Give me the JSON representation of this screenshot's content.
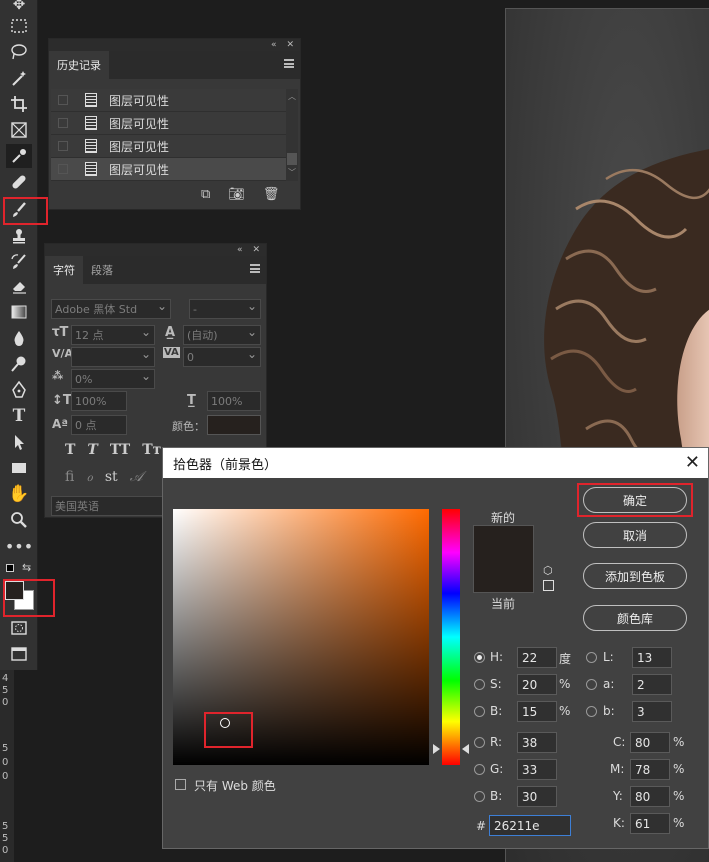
{
  "toolbar": {
    "tools": [
      "move-icon",
      "marquee-icon",
      "lasso-icon",
      "magic-wand-icon",
      "crop-icon",
      "frame-icon",
      "eyedropper-icon",
      "healing-brush-icon",
      "brush-icon",
      "stamp-icon",
      "history-brush-icon",
      "eraser-icon",
      "gradient-icon",
      "blur-icon",
      "dodge-icon",
      "pen-icon",
      "type-icon",
      "path-selection-icon",
      "rectangle-icon",
      "hand-icon",
      "zoom-icon",
      "more-tools-icon"
    ]
  },
  "ruler": {
    "numbers": [
      "4",
      "5",
      "0",
      "5",
      "0",
      "0",
      "5",
      "5",
      "0"
    ]
  },
  "history": {
    "tab": "历史记录",
    "items": [
      "图层可见性",
      "图层可见性",
      "图层可见性",
      "图层可见性"
    ]
  },
  "character": {
    "tabs": [
      "字符",
      "段落"
    ],
    "font_family": "Adobe 黑体 Std",
    "font_style": "-",
    "size": "12 点",
    "leading": "(自动)",
    "kerning": "",
    "tracking": "0",
    "tsume": "0%",
    "vscale": "100%",
    "hscale": "100%",
    "baseline": "0 点",
    "color_label": "颜色：",
    "language": "美国英语",
    "style_row1": [
      "T",
      "T",
      "TT",
      "Tт"
    ],
    "style_row2": [
      "fi",
      "ℴ",
      "st",
      "𝒜"
    ]
  },
  "picker": {
    "title": "拾色器（前景色）",
    "new_label": "新的",
    "current_label": "当前",
    "ok": "确定",
    "cancel": "取消",
    "add_swatch": "添加到色板",
    "color_library": "颜色库",
    "web_only": "只有 Web 颜色",
    "hsb": [
      {
        "label": "H:",
        "value": "22",
        "unit": "度"
      },
      {
        "label": "S:",
        "value": "20",
        "unit": "%"
      },
      {
        "label": "B:",
        "value": "15",
        "unit": "%"
      }
    ],
    "rgb": [
      {
        "label": "R:",
        "value": "38"
      },
      {
        "label": "G:",
        "value": "33"
      },
      {
        "label": "B:",
        "value": "30"
      }
    ],
    "lab": [
      {
        "label": "L:",
        "value": "13"
      },
      {
        "label": "a:",
        "value": "2"
      },
      {
        "label": "b:",
        "value": "3"
      }
    ],
    "cmyk": [
      {
        "label": "C:",
        "value": "80",
        "unit": "%"
      },
      {
        "label": "M:",
        "value": "78",
        "unit": "%"
      },
      {
        "label": "Y:",
        "value": "80",
        "unit": "%"
      },
      {
        "label": "K:",
        "value": "61",
        "unit": "%"
      }
    ],
    "hex_label": "#",
    "hex": "26211e",
    "colors": {
      "new": "#26211e",
      "current": "#26211e",
      "hue": "#ff6a00"
    }
  }
}
